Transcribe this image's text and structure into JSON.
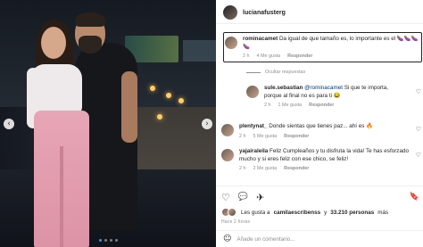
{
  "post": {
    "username": "lucianafusterg"
  },
  "comments": [
    {
      "user": "rominacamet",
      "text": "Da igual de que tamaño es, lo importante es el 🍆🍆🍆🍆",
      "time": "2 h",
      "likes": "4 Me gusta",
      "reply": "Responder"
    },
    {
      "user": "sule.sebastian",
      "mention": "@rominacamet",
      "text": "Si que te importa, porque al final no es para ti 😂",
      "time": "2 h",
      "likes": "1 Me gusta",
      "reply": "Responder"
    },
    {
      "user": "plentynat_",
      "text": "Donde sientas que tienes paz... ahí es 🔥",
      "time": "2 h",
      "likes": "5 Me gusta",
      "reply": "Responder"
    },
    {
      "user": "yajairaleila",
      "text": "Feliz Cumpleaños y tu disfruta la vida! Te has esforzado mucho y si eres feliz con ese chico, se feliz!",
      "time": "2 h",
      "likes": "2 Me gusta",
      "reply": "Responder"
    }
  ],
  "hide_replies": "Ocultar respuestas",
  "likes": {
    "prefix": "Les gusta a",
    "user": "camilaescribenss",
    "connector": "y",
    "count": "33.210 personas",
    "suffix": "más"
  },
  "date": "Hace 2 horas",
  "add_comment": {
    "placeholder": "Añade un comentario..."
  },
  "icons": {
    "heart": "♡",
    "comment": "💬",
    "share": "✈",
    "save": "🔖",
    "emoji": "☺",
    "prev": "‹",
    "next": "›"
  }
}
